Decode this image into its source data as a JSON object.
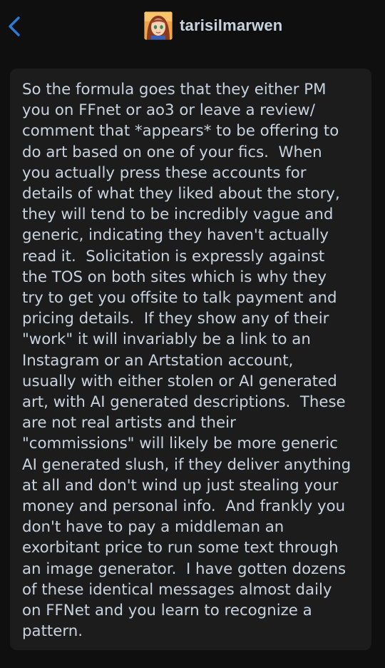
{
  "header": {
    "username": "tarisilmarwen",
    "accent_color": "#2e7bd6"
  },
  "post": {
    "lines": [
      "So the formula goes that they either PM",
      "you on FFnet or ao3 or leave a review/",
      "comment that *appears* to be offering to",
      "do art based on one of your fics.  When",
      "you actually press these accounts for",
      "details of what they liked about the story,",
      "they will tend to be incredibly vague and",
      "generic, indicating they haven't actually",
      "read it.  Solicitation is expressly against",
      "the TOS on both sites which is why they",
      "try to get you offsite to talk payment and",
      "pricing details.  If they show any of their",
      "\"work\" it will invariably be a link to an",
      "Instagram or an Artstation account,",
      "usually with either stolen or AI generated",
      "art, with AI generated descriptions.  These",
      "are not real artists and their",
      "\"commissions\" will likely be more generic",
      "AI generated slush, if they deliver anything",
      "at all and don't wind up just stealing your",
      "money and personal info.  And frankly you",
      "don't have to pay a middleman an",
      "exorbitant price to run some text through",
      "an image generator.  I have gotten dozens",
      "of these identical messages almost daily",
      "on FFNet and you learn to recognize a",
      "pattern."
    ]
  }
}
